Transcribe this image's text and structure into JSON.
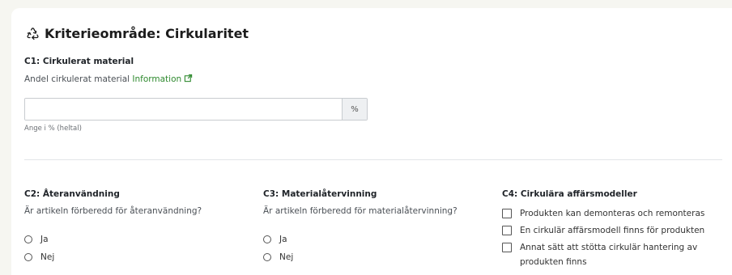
{
  "section": {
    "title": "Kriterieområde: Cirkularitet",
    "icon": "recycle-icon"
  },
  "c1": {
    "label": "C1: Cirkulerat material",
    "sub": "Andel cirkulerat material",
    "info_link": "Information",
    "input_value": "",
    "unit": "%",
    "hint": "Ange i % (heltal)"
  },
  "c2": {
    "label": "C2: Återanvändning",
    "question": "Är artikeln förberedd för återanvändning?",
    "options": [
      "Ja",
      "Nej"
    ]
  },
  "c3": {
    "label": "C3: Materialåtervinning",
    "question": "Är artikeln förberedd för materialåtervinning?",
    "options": [
      "Ja",
      "Nej"
    ]
  },
  "c4": {
    "label": "C4: Cirkulära affärsmodeller",
    "options": [
      "Produkten kan demonteras och remonteras",
      "En cirkulär affärsmodell finns för produkten",
      "Annat sätt att stötta cirkulär hantering av produkten finns"
    ]
  },
  "colors": {
    "link": "#2f8a2f",
    "background": "#f6f6f1"
  }
}
